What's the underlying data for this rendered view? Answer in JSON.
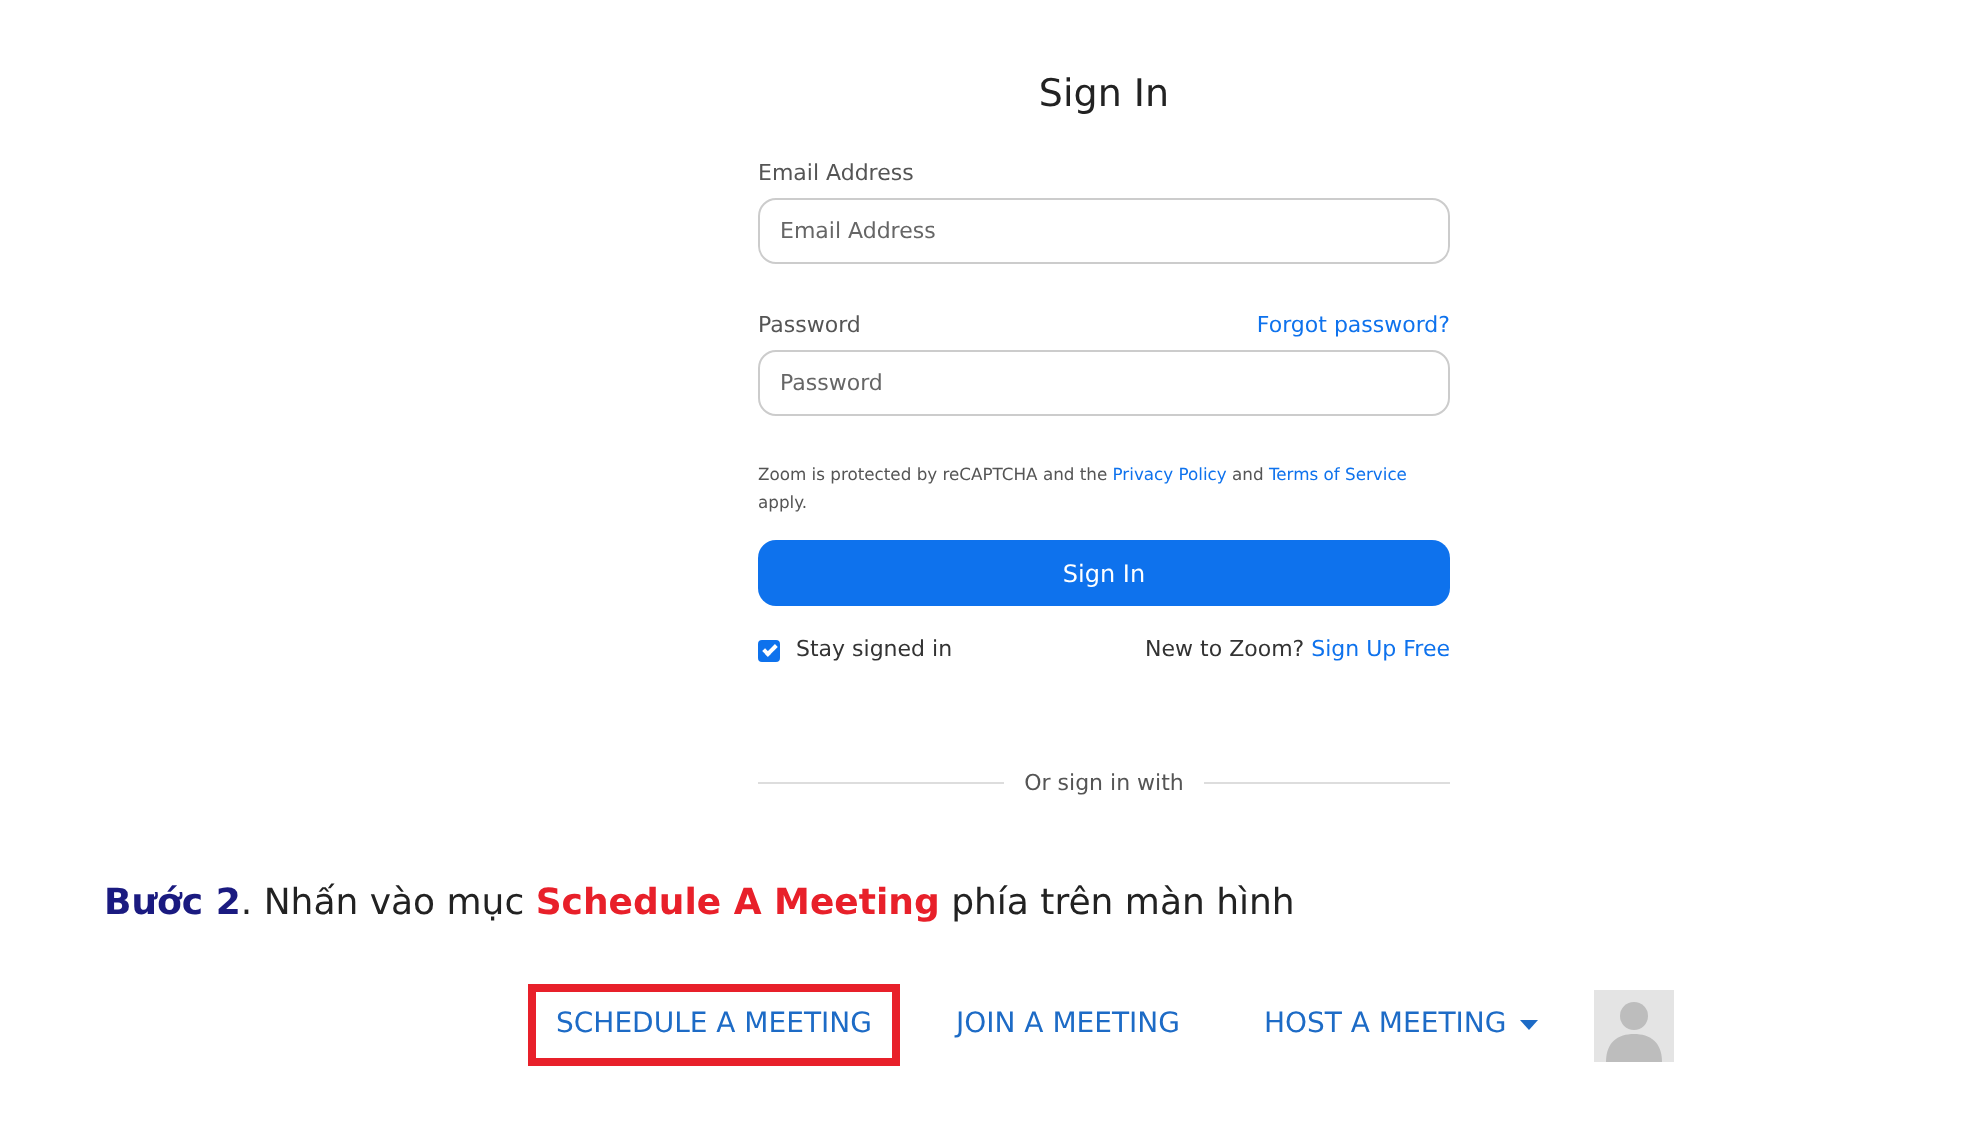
{
  "sign_in": {
    "title": "Sign In",
    "email": {
      "label": "Email Address",
      "placeholder": "Email Address"
    },
    "password": {
      "label": "Password",
      "placeholder": "Password",
      "forgot_link": "Forgot password?"
    },
    "recaptcha_notice": [
      {
        "kind": "plain",
        "text": "Zoom is protected by reCAPTCHA and the "
      },
      {
        "kind": "link",
        "text": "Privacy Policy"
      },
      {
        "kind": "plain",
        "text": " and "
      },
      {
        "kind": "link",
        "text": "Terms of Service"
      },
      {
        "kind": "plain",
        "text": " apply."
      }
    ],
    "submit_button": "Sign In",
    "stay_signed_in": {
      "label": "Stay signed in",
      "checked": true
    },
    "signup_prompt": "New to Zoom?",
    "signup_link": "Sign Up Free",
    "divider_text": "Or sign in with"
  },
  "instruction": [
    {
      "kind": "step",
      "text": "Bước 2"
    },
    {
      "kind": "plain",
      "text": ". Nhấn vào mục "
    },
    {
      "kind": "highlight",
      "text": "Schedule A Meeting"
    },
    {
      "kind": "plain",
      "text": " phía trên màn hình"
    }
  ],
  "top_nav": {
    "items": [
      {
        "label": "SCHEDULE A MEETING",
        "highlighted": true,
        "dropdown": false
      },
      {
        "label": "JOIN A MEETING",
        "highlighted": false,
        "dropdown": false
      },
      {
        "label": "HOST A MEETING",
        "highlighted": false,
        "dropdown": true
      }
    ]
  }
}
